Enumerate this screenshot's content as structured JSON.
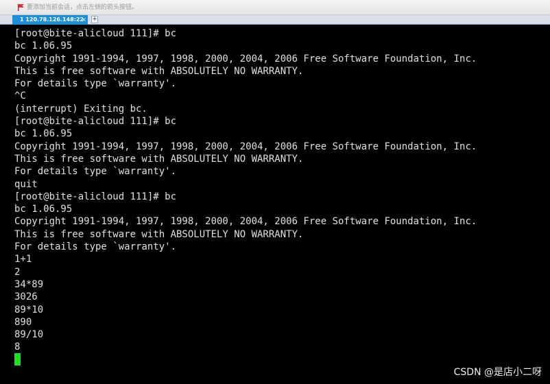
{
  "notification": {
    "icon": "flag-icon",
    "icon_color": "#d9363e",
    "text": "要添加当前会话，点击左侧的箭头按钮。"
  },
  "tabs": [
    {
      "label": "1 120.78.126.148:22",
      "close_label": "×",
      "active": true,
      "color": "#1f8fd8"
    }
  ],
  "new_tab_label": "+",
  "terminal": {
    "background": "#000000",
    "foreground": "#e0e0e0",
    "cursor_color": "#1fe01f",
    "lines": [
      "[root@bite-alicloud 111]# bc",
      "bc 1.06.95",
      "Copyright 1991-1994, 1997, 1998, 2000, 2004, 2006 Free Software Foundation, Inc.",
      "This is free software with ABSOLUTELY NO WARRANTY.",
      "For details type `warranty'.",
      "^C",
      "(interrupt) Exiting bc.",
      "[root@bite-alicloud 111]# bc",
      "bc 1.06.95",
      "Copyright 1991-1994, 1997, 1998, 2000, 2004, 2006 Free Software Foundation, Inc.",
      "This is free software with ABSOLUTELY NO WARRANTY.",
      "For details type `warranty'.",
      "quit",
      "[root@bite-alicloud 111]# bc",
      "bc 1.06.95",
      "Copyright 1991-1994, 1997, 1998, 2000, 2004, 2006 Free Software Foundation, Inc.",
      "This is free software with ABSOLUTELY NO WARRANTY.",
      "For details type `warranty'.",
      "1+1",
      "2",
      "34*89",
      "3026",
      "89*10",
      "890",
      "89/10",
      "8"
    ]
  },
  "watermark": "CSDN @是店小二呀"
}
